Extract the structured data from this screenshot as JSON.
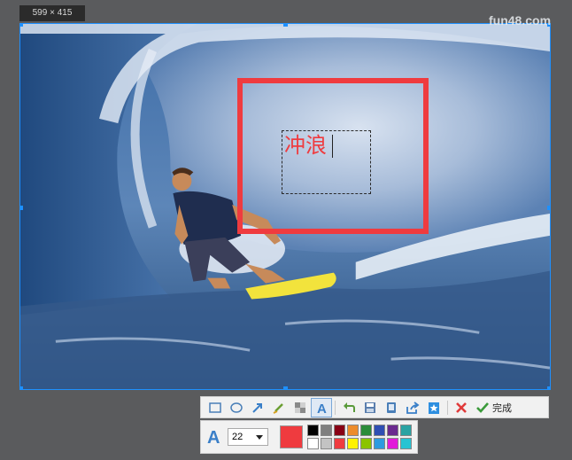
{
  "selection": {
    "size_label": "599 × 415"
  },
  "image": {
    "watermark": "fun48.com"
  },
  "annotation": {
    "text": "冲浪",
    "color": "#ef3b3f"
  },
  "toolbar": {
    "tools": [
      {
        "name": "rectangle-tool",
        "icon": "rectangle-icon"
      },
      {
        "name": "ellipse-tool",
        "icon": "ellipse-icon"
      },
      {
        "name": "arrow-tool",
        "icon": "arrow-icon"
      },
      {
        "name": "brush-tool",
        "icon": "brush-icon"
      },
      {
        "name": "mosaic-tool",
        "icon": "mosaic-icon"
      },
      {
        "name": "text-tool",
        "icon": "text-icon",
        "active": true
      },
      {
        "name": "undo-button",
        "icon": "undo-icon"
      },
      {
        "name": "save-button",
        "icon": "save-icon"
      },
      {
        "name": "copy-button",
        "icon": "copy-icon"
      },
      {
        "name": "share-button",
        "icon": "share-icon"
      },
      {
        "name": "pin-button",
        "icon": "pin-icon"
      },
      {
        "name": "cancel-button",
        "icon": "close-icon"
      }
    ],
    "done_label": "完成"
  },
  "text_props": {
    "font_size": "22",
    "current_color": "#ef3b3f",
    "palette": [
      "#000000",
      "#7f7f7f",
      "#880015",
      "#ed8c2b",
      "#2b8c3a",
      "#2f4fb3",
      "#6a2a8f",
      "#2aa3a3",
      "#ffffff",
      "#c3c3c3",
      "#ef3b3f",
      "#fff200",
      "#8bc400",
      "#2e9be0",
      "#e21ad9",
      "#27c3d2"
    ]
  }
}
